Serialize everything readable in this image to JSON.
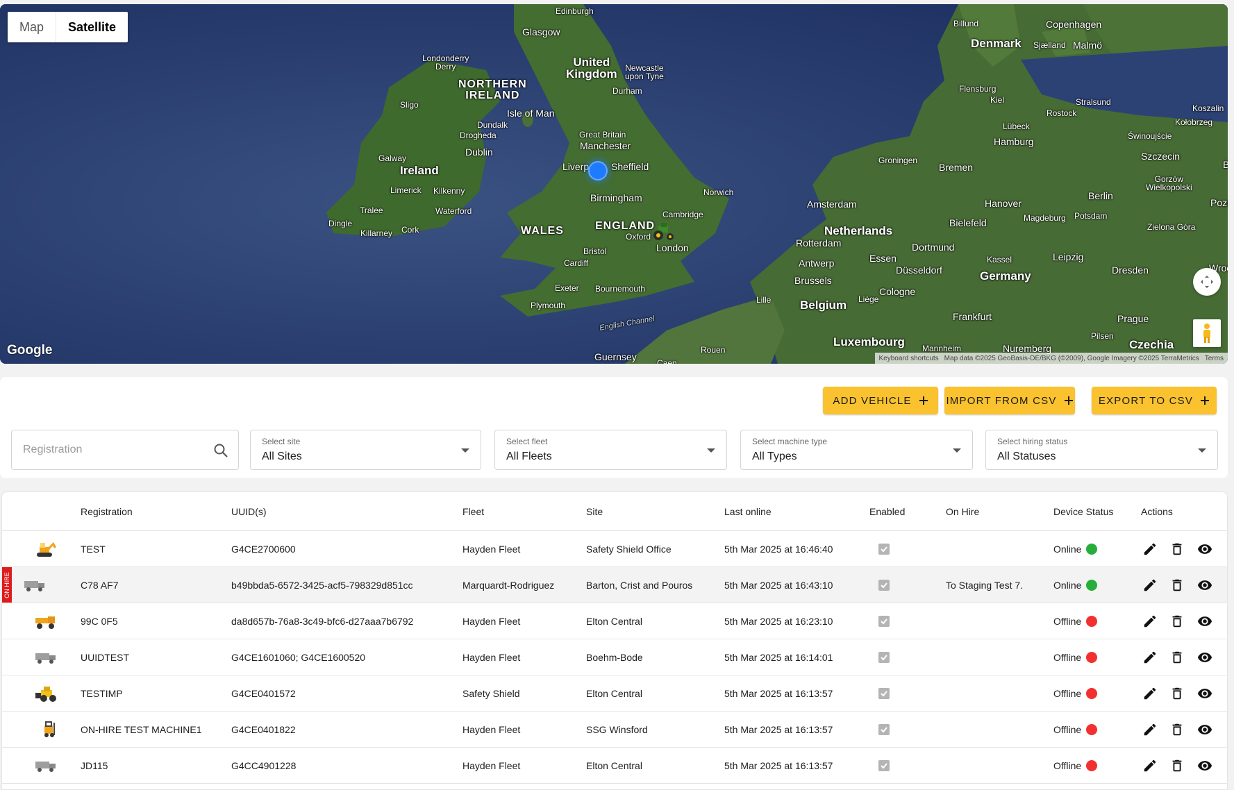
{
  "map": {
    "toggle": {
      "map_label": "Map",
      "satellite_label": "Satellite",
      "active": "Satellite"
    },
    "labels": {
      "edinburgh": "Edinburgh",
      "glasgow": "Glasgow",
      "united_kingdom": "United\nKingdom",
      "londonderry": "Londonderry\nDerry",
      "northern_ireland": "NORTHERN\nIRELAND",
      "newcastle": "Newcastle\nupon Tyne",
      "durham": "Durham",
      "sligo": "Sligo",
      "isle_of_man": "Isle of Man",
      "dundalk": "Dundalk",
      "drogheda": "Drogheda",
      "great_britain": "Great Britain",
      "manchester": "Manchester",
      "dublin": "Dublin",
      "galway": "Galway",
      "ireland": "Ireland",
      "liverpool": "Liverp",
      "sheffield": "Sheffield",
      "limerick": "Limerick",
      "kilkenny": "Kilkenny",
      "birmingham": "Birmingham",
      "norwich": "Norwich",
      "tralee": "Tralee",
      "waterford": "Waterford",
      "cambridge": "Cambridge",
      "dingle": "Dingle",
      "killarney": "Killarney",
      "cork": "Cork",
      "wales": "WALES",
      "england": "ENGLAND",
      "oxford": "Oxford",
      "london": "London",
      "bristol": "Bristol",
      "cardiff": "Cardiff",
      "exeter": "Exeter",
      "bournemouth": "Bournemouth",
      "plymouth": "Plymouth",
      "english_channel": "English Channel",
      "guernsey": "Guernsey",
      "caen": "Caen",
      "rouen": "Rouen",
      "lille": "Lille",
      "billund": "Billund",
      "denmark": "Denmark",
      "copenhagen": "Copenhagen",
      "sjaelland": "Sjælland",
      "malmo": "Malmö",
      "flensburg": "Flensburg",
      "kiel": "Kiel",
      "stralsund": "Stralsund",
      "rostock": "Rostock",
      "koszalin": "Koszalin",
      "kolobrzeg": "Kołobrzeg",
      "lubeck": "Lübeck",
      "hamburg": "Hamburg",
      "swinoujscie": "Świnoujście",
      "szczecin": "Szczecin",
      "groningen": "Groningen",
      "bremen": "Bremen",
      "gorzow": "Gorzów\nWielkopolski",
      "amsterdam": "Amsterdam",
      "hanover": "Hanover",
      "berlin": "Berlin",
      "poznan": "Poznań",
      "netherlands": "Netherlands",
      "bielefeld": "Bielefeld",
      "magdeburg": "Magdeburg",
      "potsdam": "Potsdam",
      "zielona_gora": "Zielona Góra",
      "rotterdam": "Rotterdam",
      "dortmund": "Dortmund",
      "essen": "Essen",
      "kassel": "Kassel",
      "leipzig": "Leipzig",
      "antwerp": "Antwerp",
      "dusseldorf": "Düsseldorf",
      "wroclaw": "Wrocła",
      "brussels": "Brussels",
      "germany": "Germany",
      "dresden": "Dresden",
      "cologne": "Cologne",
      "liege": "Liège",
      "belgium": "Belgium",
      "frankfurt": "Frankfurt",
      "prague": "Prague",
      "luxembourg": "Luxembourg",
      "pilsen": "Pilsen",
      "mannheim": "Mannheim",
      "nuremberg": "Nuremberg",
      "czechia": "Czechia",
      "b": "B"
    },
    "google_logo": "Google",
    "attribution": {
      "shortcuts": "Keyboard shortcuts",
      "data": "Map data ©2025 GeoBasis-DE/BKG (©2009), Google Imagery ©2025 TerraMetrics",
      "terms": "Terms"
    }
  },
  "toolbar": {
    "add_vehicle": "ADD VEHICLE",
    "import_csv": "IMPORT FROM CSV",
    "export_csv": "EXPORT TO CSV",
    "button_color": "#f9c22e"
  },
  "filters": {
    "registration_placeholder": "Registration",
    "site": {
      "label": "Select site",
      "value": "All Sites"
    },
    "fleet": {
      "label": "Select fleet",
      "value": "All Fleets"
    },
    "machine_type": {
      "label": "Select machine type",
      "value": "All Types"
    },
    "hiring_status": {
      "label": "Select hiring status",
      "value": "All Statuses"
    }
  },
  "table": {
    "headers": {
      "registration": "Registration",
      "uuids": "UUID(s)",
      "fleet": "Fleet",
      "site": "Site",
      "last_online": "Last online",
      "enabled": "Enabled",
      "on_hire": "On Hire",
      "device_status": "Device Status",
      "actions": "Actions"
    },
    "on_hire_badge": "ON HIRE",
    "status_colors": {
      "Online": "#27ae3a",
      "Offline": "#f23030"
    },
    "rows": [
      {
        "icon": "excavator",
        "registration": "TEST",
        "uuids": "G4CE2700600",
        "fleet": "Hayden Fleet",
        "site": "Safety Shield Office",
        "last_online": "5th Mar 2025 at 16:46:40",
        "enabled": true,
        "on_hire": "",
        "status": "Online",
        "highlight": false
      },
      {
        "icon": "truck",
        "registration": "C78 AF7",
        "uuids": "b49bbda5-6572-3425-acf5-798329d851cc",
        "fleet": "Marquardt-Rodriguez",
        "site": "Barton, Crist and Pouros",
        "last_online": "5th Mar 2025 at 16:43:10",
        "enabled": true,
        "on_hire": "To Staging Test 7.",
        "status": "Online",
        "highlight": true
      },
      {
        "icon": "dumper",
        "registration": "99C 0F5",
        "uuids": "da8d657b-76a8-3c49-bfc6-d27aaa7b6792",
        "fleet": "Hayden Fleet",
        "site": "Elton Central",
        "last_online": "5th Mar 2025 at 16:23:10",
        "enabled": true,
        "on_hire": "",
        "status": "Offline",
        "highlight": false
      },
      {
        "icon": "truck",
        "registration": "UUIDTEST",
        "uuids": "G4CE1601060; G4CE1600520",
        "fleet": "Hayden Fleet",
        "site": "Boehm-Bode",
        "last_online": "5th Mar 2025 at 16:14:01",
        "enabled": true,
        "on_hire": "",
        "status": "Offline",
        "highlight": false
      },
      {
        "icon": "loader",
        "registration": "TESTIMP",
        "uuids": "G4CE0401572",
        "fleet": "Safety Shield",
        "site": "Elton Central",
        "last_online": "5th Mar 2025 at 16:13:57",
        "enabled": true,
        "on_hire": "",
        "status": "Offline",
        "highlight": false
      },
      {
        "icon": "forklift",
        "registration": "ON-HIRE TEST MACHINE1",
        "uuids": "G4CE0401822",
        "fleet": "Hayden Fleet",
        "site": "SSG Winsford",
        "last_online": "5th Mar 2025 at 16:13:57",
        "enabled": true,
        "on_hire": "",
        "status": "Offline",
        "highlight": false
      },
      {
        "icon": "truck",
        "registration": "JD115",
        "uuids": "G4CC4901228",
        "fleet": "Hayden Fleet",
        "site": "Elton Central",
        "last_online": "5th Mar 2025 at 16:13:57",
        "enabled": true,
        "on_hire": "",
        "status": "Offline",
        "highlight": false
      }
    ]
  }
}
